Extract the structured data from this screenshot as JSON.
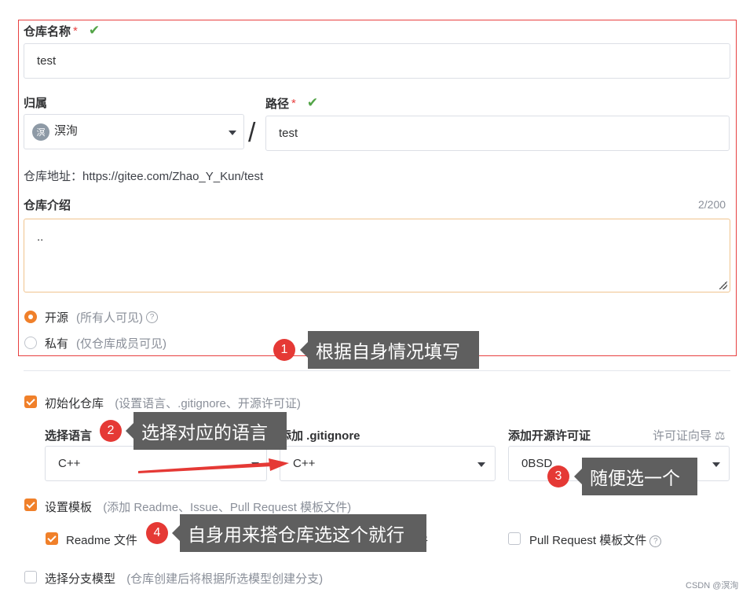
{
  "repo_name": {
    "label": "仓库名称",
    "required_mark": "*",
    "valid_icon": "✔",
    "value": "test"
  },
  "owner": {
    "label": "归属",
    "avatar_text": "溟",
    "value": "溟洵",
    "separator": "/"
  },
  "path": {
    "label": "路径",
    "required_mark": "*",
    "valid_icon": "✔",
    "value": "test"
  },
  "repo_address": {
    "label": "仓库地址：",
    "url": "https://gitee.com/Zhao_Y_Kun/test"
  },
  "intro": {
    "label": "仓库介绍",
    "counter": "2/200",
    "value": ".."
  },
  "visibility": {
    "open_label": "开源",
    "open_hint": "(所有人可见)",
    "private_label": "私有",
    "private_hint": "(仅仓库成员可见)",
    "help_icon": "?"
  },
  "init": {
    "label": "初始化仓库",
    "hint": "(设置语言、.gitignore、开源许可证)"
  },
  "language": {
    "label": "选择语言",
    "value": "C++"
  },
  "gitignore": {
    "label": "添加 .gitignore",
    "value": "C++"
  },
  "license": {
    "label": "添加开源许可证",
    "guide_link": "许可证向导",
    "guide_icon": "⚖",
    "value": "0BSD"
  },
  "template": {
    "label": "设置模板",
    "hint": "(添加 Readme、Issue、Pull Request 模板文件)",
    "readme_label": "Readme 文件",
    "issue_label_fragment": "文件",
    "pr_label": "Pull Request 模板文件"
  },
  "branch_model": {
    "label": "选择分支模型",
    "hint": "(仓库创建后将根据所选模型创建分支)"
  },
  "annotations": [
    {
      "num": "1",
      "text": "根据自身情况填写"
    },
    {
      "num": "2",
      "text": "选择对应的语言"
    },
    {
      "num": "3",
      "text": "随便选一个"
    },
    {
      "num": "4",
      "text": "自身用来搭仓库选这个就行"
    }
  ],
  "watermark": "CSDN @溟洵",
  "colors": {
    "accent": "#f0802a",
    "valid": "#52a447",
    "annotation_red": "#e53935",
    "frame_red": "#e84040"
  }
}
